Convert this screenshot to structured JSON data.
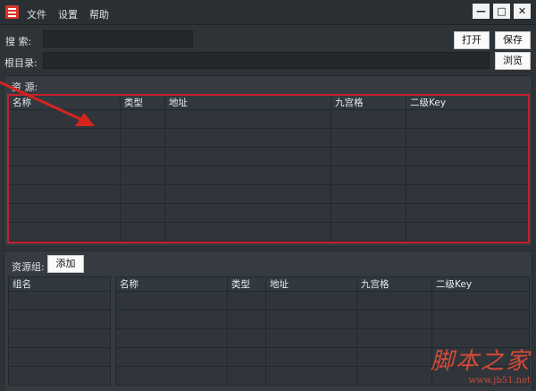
{
  "menu": {
    "file": "文件",
    "settings": "设置",
    "help": "帮助"
  },
  "window": {
    "minimize": "—",
    "maximize": "□",
    "close": "✕"
  },
  "search": {
    "label": "搜  索:",
    "value": ""
  },
  "root": {
    "label": "根目录:",
    "value": ""
  },
  "buttons": {
    "open": "打开",
    "save": "保存",
    "browse": "浏览",
    "add": "添加"
  },
  "resources": {
    "title": "资  源:",
    "columns": [
      "名称",
      "类型",
      "地址",
      "九宫格",
      "二级Key"
    ],
    "rows": 7
  },
  "groups": {
    "title": "资源组:",
    "group_col": "组名",
    "columns": [
      "名称",
      "类型",
      "地址",
      "九宫格",
      "二级Key"
    ]
  },
  "watermark": {
    "main": "脚本之家",
    "url": "www.jb51.net"
  },
  "colors": {
    "accent_red": "#c8202c",
    "background": "#2e3338"
  }
}
